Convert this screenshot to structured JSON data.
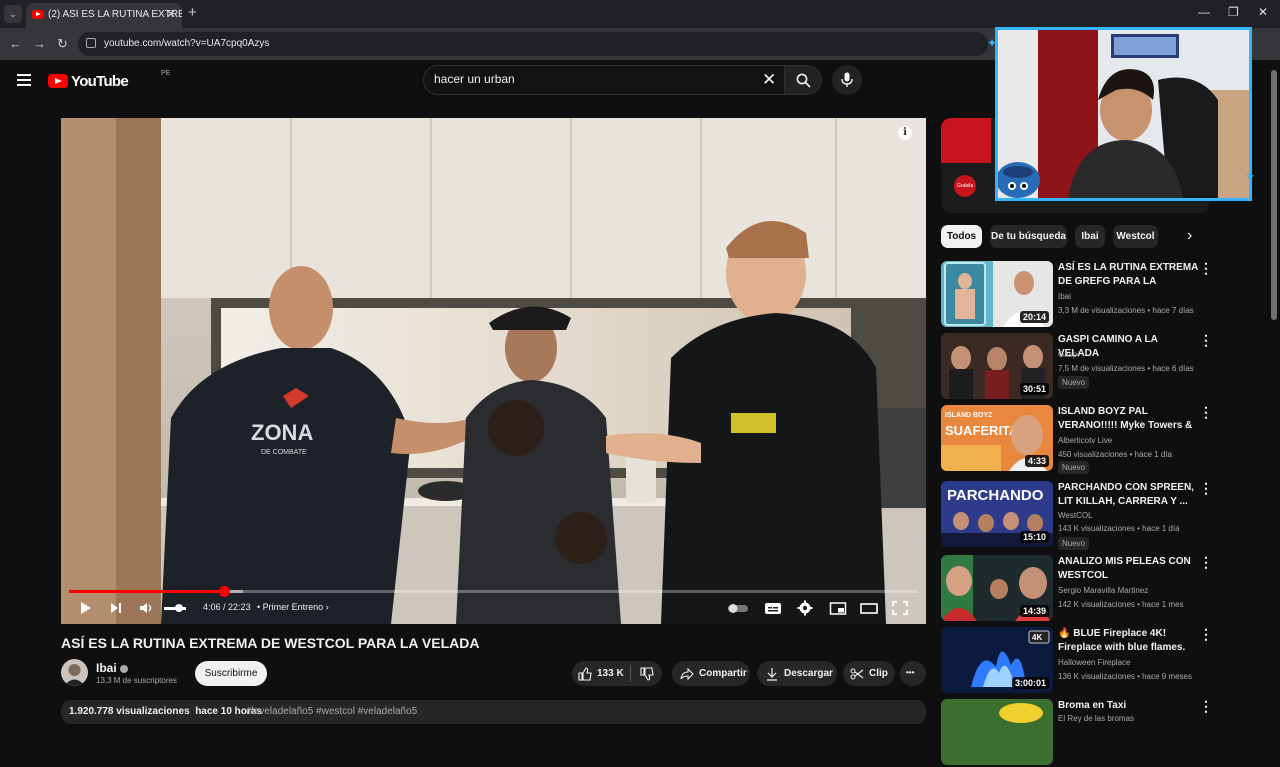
{
  "browser": {
    "tab_title": "(2) ASÍ ES LA RUTINA EXTREMA",
    "tab_close": "✕",
    "new_tab": "+",
    "url": "youtube.com/watch?v=UA7cpq0Azys",
    "back": "←",
    "forward": "→",
    "reload": "↻",
    "minimize": "—",
    "maximize": "❐",
    "close": "✕"
  },
  "header": {
    "logo_text": "YouTube",
    "region": "PE",
    "search_value": "hacer un urban",
    "clear_symbol": "✕"
  },
  "player": {
    "current_time": "4:06",
    "separator": " / ",
    "duration": "22:23",
    "chapter": "Primer Entreno",
    "progress_fraction": 0.183,
    "buffer_fraction": 0.205,
    "info_symbol": "i"
  },
  "video": {
    "title": "ASÍ ES LA RUTINA EXTREMA DE WESTCOL PARA LA VELADA",
    "channel": "Ibai",
    "subscribers": "13,3 M de suscriptores",
    "subscribe_label": "Suscribirme",
    "likes": "133 K",
    "share_label": "Compartir",
    "download_label": "Descargar",
    "clip_label": "Clip",
    "more_label": "•••",
    "views": "1.920.778 visualizaciones",
    "posted": "hace 10 horas",
    "tags": "#laveladelaño5 #westcol #veladelaño5"
  },
  "chips": [
    {
      "label": "Todos",
      "active": true
    },
    {
      "label": "De tu búsqueda",
      "active": false
    },
    {
      "label": "Ibai",
      "active": false
    },
    {
      "label": "Westcol",
      "active": false
    }
  ],
  "chips_next": "›",
  "recommendations": [
    {
      "title": "ASÍ ES LA RUTINA EXTREMA DE GREFG PARA LA VELADA",
      "channel": "Ibai",
      "meta": "3,3 M de visualizaciones • hace 7 días",
      "duration": "20:14",
      "badge": ""
    },
    {
      "title": "GASPI CAMINO A LA VELADA",
      "channel": "Gaspi",
      "meta": "7,5 M de visualizaciones • hace 6 días",
      "duration": "30:51",
      "badge": "Nuevo"
    },
    {
      "title": "ISLAND BOYZ PAL VERANO!!!!! Myke Towers & iZaak - ...",
      "channel": "Alberticotv Live",
      "meta": "450 visualizaciones • hace 1 día",
      "duration": "4:33",
      "badge": "Nuevo"
    },
    {
      "title": "PARCHANDO CON SPREEN, LIT KILLAH, CARRERA Y ...",
      "channel": "WestCOL",
      "meta": "143 K visualizaciones • hace 1 día",
      "duration": "15:10",
      "badge": "Nuevo"
    },
    {
      "title": "ANALIZO MIS PELEAS CON WESTCOL",
      "channel": "Sergio Maravilla Martinez",
      "meta": "142 K visualizaciones • hace 1 mes",
      "duration": "14:39",
      "badge": ""
    },
    {
      "title": "🔥 BLUE Fireplace 4K! Fireplace with blue flames. Halloween ...",
      "channel": "Halloween Fireplace",
      "meta": "136 K visualizaciones • hace 9 meses",
      "duration": "3:00:01",
      "badge": ""
    },
    {
      "title": "Broma en Taxi",
      "channel": "El Rey de las bromas",
      "meta": "",
      "duration": "",
      "badge": ""
    }
  ],
  "thumb_texts": {
    "t3": "ISLAND BOYZ",
    "t3b": "SUAFERITA",
    "t4": "PARCHANDO",
    "t6": "4K"
  },
  "ad": {
    "logo_text": "Grabila"
  },
  "scene_text": {
    "shirt_left": "ZONA",
    "shirt_left_sub": "DE COMBATE"
  },
  "colors": {
    "accent": "#ff0000",
    "background": "#0f0f0f",
    "webcam_border": "#35b5ff"
  }
}
